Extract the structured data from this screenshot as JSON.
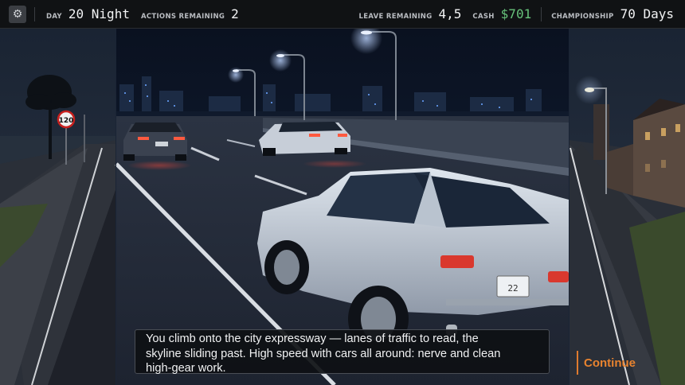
{
  "hud": {
    "settings_icon": "gear-icon",
    "day_label": "DAY",
    "day_value": "20 Night",
    "actions_label": "ACTIONS REMAINING",
    "actions_value": "2",
    "leave_label": "LEAVE REMAINING",
    "leave_value": "4,5",
    "cash_label": "CASH",
    "cash_value": "$701",
    "championship_label": "CHAMPIONSHIP",
    "championship_value": "70 Days"
  },
  "scene": {
    "speed_sign": "120",
    "plate": "22"
  },
  "dialog": {
    "line1": "You climb onto the city expressway — lanes of traffic to read, the",
    "line2": "skyline sliding past. High speed with cars all around: nerve and clean",
    "line3": "high-gear work."
  },
  "continue_label": "Continue",
  "colors": {
    "accent": "#e8832f",
    "cash": "#67c27a"
  }
}
